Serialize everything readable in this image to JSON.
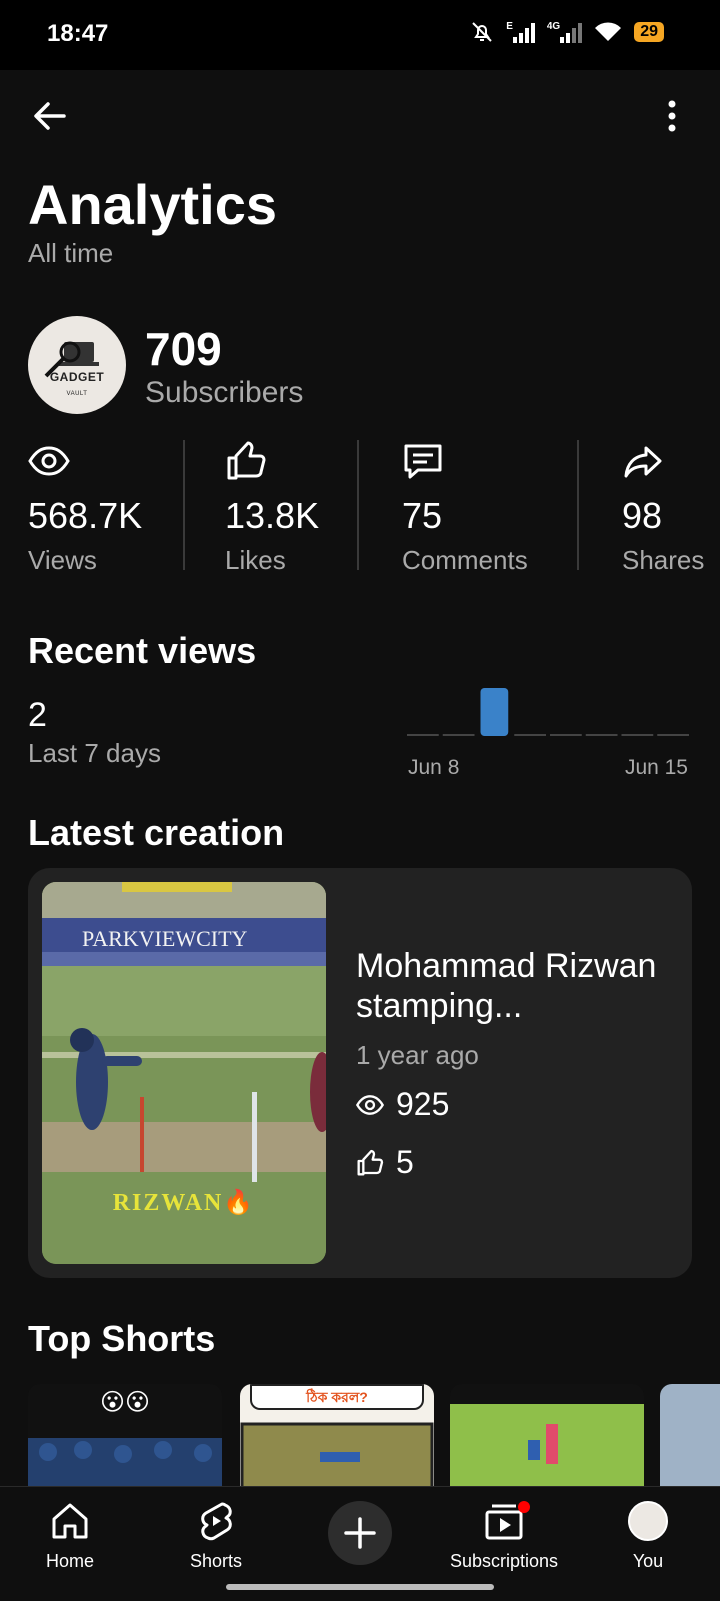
{
  "status_bar": {
    "time": "18:47",
    "network_e": "E",
    "network_4g": "4G",
    "battery": "29"
  },
  "header": {
    "title": "Analytics",
    "subtitle": "All time"
  },
  "channel": {
    "avatar_text": "GADGET",
    "avatar_subtext": "VAULT",
    "subscriber_count": "709",
    "subscriber_label": "Subscribers"
  },
  "stats": [
    {
      "icon": "eye-icon",
      "value": "568.7K",
      "label": "Views"
    },
    {
      "icon": "thumbs-up-icon",
      "value": "13.8K",
      "label": "Likes"
    },
    {
      "icon": "comment-icon",
      "value": "75",
      "label": "Comments"
    },
    {
      "icon": "share-icon",
      "value": "98",
      "label": "Shares"
    }
  ],
  "recent_views": {
    "title": "Recent views",
    "count": "2",
    "period_label": "Last 7 days",
    "chart_data": {
      "type": "bar",
      "x_start_label": "Jun 8",
      "x_end_label": "Jun 15",
      "values": [
        0,
        0,
        2,
        0,
        0,
        0,
        0,
        0
      ],
      "color": "#3a82c9"
    }
  },
  "latest_creation": {
    "section_title": "Latest creation",
    "video_title": "Mohammad Rizwan stamping...",
    "age": "1 year ago",
    "views": "925",
    "likes": "5",
    "thumb_banner": "PARKVIEWCITY",
    "thumb_caption": "RIZWAN🔥"
  },
  "top_shorts": {
    "title": "Top Shorts",
    "thumb1_emoji": "😮😮",
    "thumb2_text": "ঠিক করল?"
  },
  "bottom_nav": {
    "home": "Home",
    "shorts": "Shorts",
    "subscriptions": "Subscriptions",
    "you": "You"
  },
  "colors": {
    "background": "#0f0f0f",
    "card": "#222222",
    "accent": "#3a82c9",
    "notification_dot": "#ff0000",
    "battery": "#f5a623"
  }
}
